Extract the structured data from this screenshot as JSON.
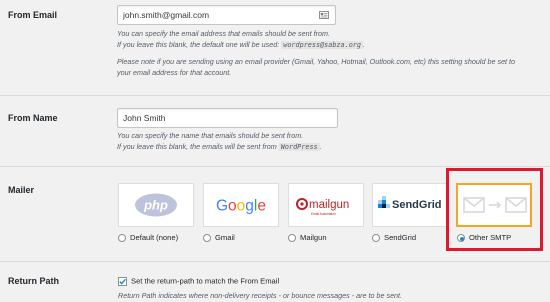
{
  "from_email": {
    "label": "From Email",
    "value": "john.smith@gmail.com",
    "desc_line1": "You can specify the email address that emails should be sent from.",
    "desc_line2_pre": "If you leave this blank, the default one will be used:",
    "desc_line2_code": "wordpress@sabza.org",
    "desc_line2_post": ".",
    "note_line1": "Please note if you are sending using an email provider (Gmail, Yahoo, Hotmail, Outlook.com, etc) this setting should be set to",
    "note_line2": "your email address for that account."
  },
  "from_name": {
    "label": "From Name",
    "value": "John Smith",
    "desc_line1": "You can specify the name that emails should be sent from.",
    "desc_line2_pre": "If you leave this blank, the emails will be sent from",
    "desc_line2_code": "WordPress",
    "desc_line2_post": "."
  },
  "mailer": {
    "label": "Mailer",
    "options": [
      {
        "label": "Default (none)",
        "logo_text": "php",
        "checked": false
      },
      {
        "label": "Gmail",
        "logo_text": "Google",
        "checked": false
      },
      {
        "label": "Mailgun",
        "logo_text": "mailgun",
        "logo_subtext": "Email Automation",
        "checked": false
      },
      {
        "label": "SendGrid",
        "logo_text": "SendGrid",
        "checked": false
      },
      {
        "label": "Other SMTP",
        "logo_text": "",
        "checked": true
      }
    ]
  },
  "return_path": {
    "label": "Return Path",
    "checkbox_label": "Set the return-path to match the From Email",
    "checked": true,
    "desc": "Return Path indicates where non-delivery receipts - or bounce messages - are to be sent."
  },
  "colors": {
    "highlight": "#e0182d",
    "smtp_orange": "#f4a623",
    "radio_accent": "#1e8cbe",
    "google_blue": "#4285f4",
    "google_red": "#ea4335",
    "google_yellow": "#fbbc05",
    "google_green": "#34a853",
    "mailgun_red": "#c02126",
    "sendgrid_blue": "#1a82e2"
  }
}
